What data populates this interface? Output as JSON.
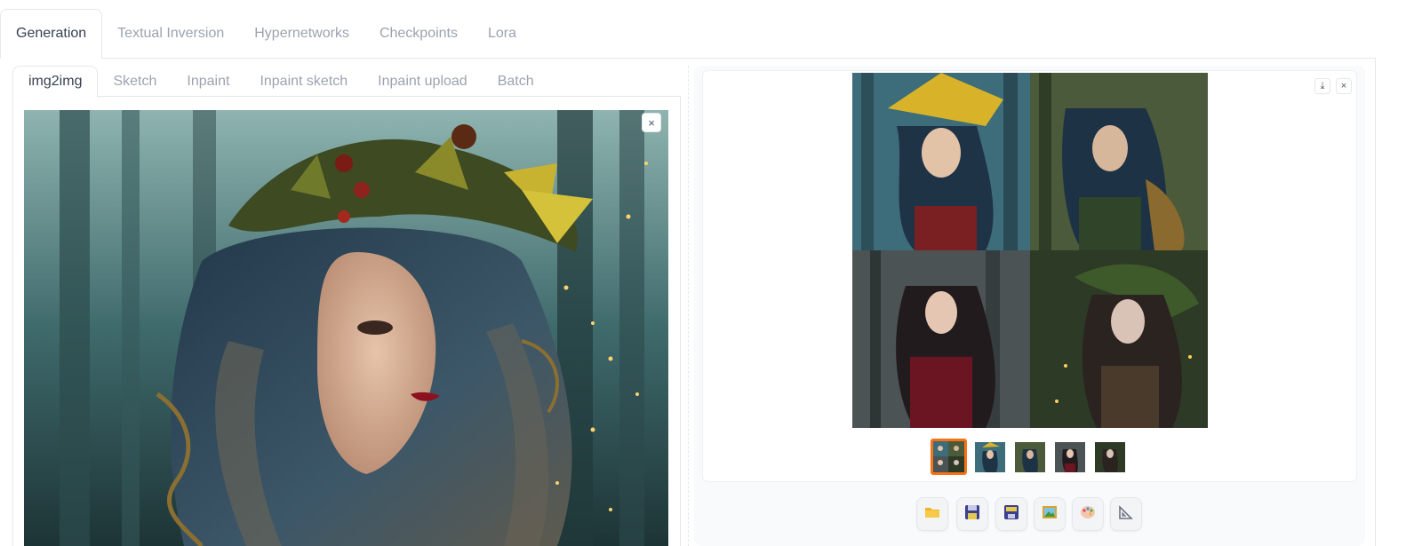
{
  "top_tabs": [
    {
      "label": "Generation",
      "active": true
    },
    {
      "label": "Textual Inversion",
      "active": false
    },
    {
      "label": "Hypernetworks",
      "active": false
    },
    {
      "label": "Checkpoints",
      "active": false
    },
    {
      "label": "Lora",
      "active": false
    }
  ],
  "sub_tabs": [
    {
      "label": "img2img",
      "active": true
    },
    {
      "label": "Sketch",
      "active": false
    },
    {
      "label": "Inpaint",
      "active": false
    },
    {
      "label": "Inpaint sketch",
      "active": false
    },
    {
      "label": "Inpaint upload",
      "active": false
    },
    {
      "label": "Batch",
      "active": false
    }
  ],
  "image_controls": {
    "clear_glyph": "×"
  },
  "gallery": {
    "download_glyph": "⤓",
    "close_glyph": "×",
    "thumbnail_count": 5,
    "selected_index": 0
  },
  "action_buttons": [
    {
      "icon": "folder-icon",
      "glyph": "📁"
    },
    {
      "icon": "save-icon",
      "glyph": "💾"
    },
    {
      "icon": "zip-icon",
      "glyph": "🗃"
    },
    {
      "icon": "send-to-img2img-icon",
      "glyph": "🖼"
    },
    {
      "icon": "send-to-inpaint-icon",
      "glyph": "🎨"
    },
    {
      "icon": "send-to-extras-icon",
      "glyph": "📐"
    }
  ],
  "colors": {
    "accent": "#f97316",
    "tab_active": "#374151",
    "tab_inactive": "#9ca3af"
  }
}
